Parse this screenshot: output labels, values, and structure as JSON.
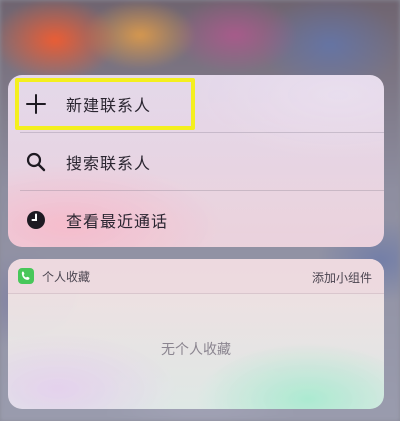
{
  "quick_actions": {
    "items": [
      {
        "label": "新建联系人",
        "icon": "plus-icon"
      },
      {
        "label": "搜索联系人",
        "icon": "search-icon"
      },
      {
        "label": "查看最近通话",
        "icon": "clock-icon"
      }
    ]
  },
  "widget": {
    "title": "个人收藏",
    "add_label": "添加小组件",
    "empty_text": "无个人收藏",
    "icon": "phone-icon"
  },
  "colors": {
    "highlight": "#f4ef1e",
    "widget_icon": "#48c75a"
  }
}
